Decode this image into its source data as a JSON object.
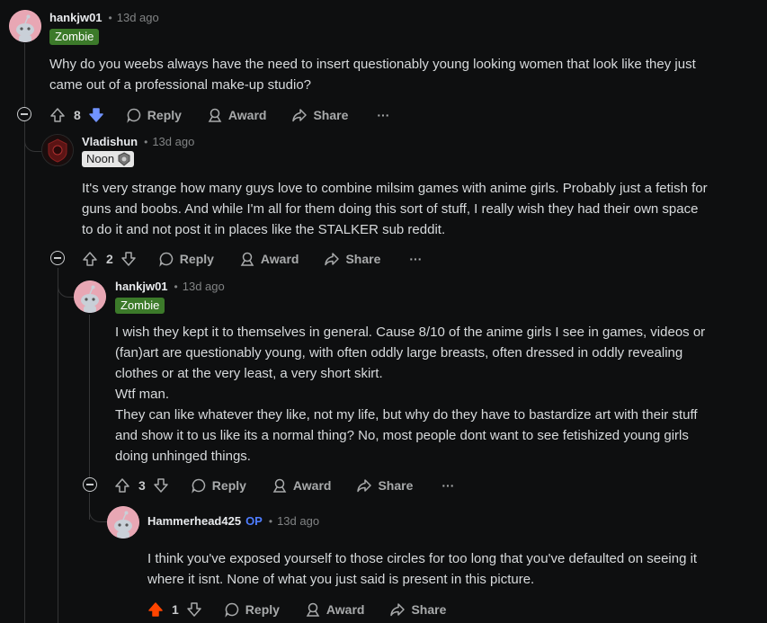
{
  "comments": [
    {
      "username": "hankjw01",
      "time": "13d ago",
      "flair": "Zombie",
      "lines": [
        "Why do you weebs always have the need to insert questionably young looking women that look like they just",
        "came out of a professional make-up studio?"
      ],
      "votes": "8",
      "vote_state": "downvoted"
    },
    {
      "username": "Vladishun",
      "time": "13d ago",
      "flair": "Noon",
      "lines": [
        "It's very strange how many guys love to combine milsim games with anime girls. Probably just a fetish for",
        "guns and boobs. And while I'm all for them doing this sort of stuff, I really wish they had their own space",
        "to do it and not post it in places like the STALKER sub reddit."
      ],
      "votes": "2",
      "vote_state": "none"
    },
    {
      "username": "hankjw01",
      "time": "13d ago",
      "flair": "Zombie",
      "lines": [
        "I wish they kept it to themselves in general. Cause 8/10 of the anime girls I see in games, videos or",
        "(fan)art are questionably young, with often oddly large breasts, often dressed in oddly revealing",
        "clothes or at the very least, a very short skirt.",
        "Wtf man.",
        "They can like whatever they like, not my life, but why do they have to bastardize art with their stuff",
        "and show it to us like its a normal thing? No, most people dont want to see fetishized young girls",
        "doing unhinged things."
      ],
      "votes": "3",
      "vote_state": "none"
    },
    {
      "username": "Hammerhead425",
      "op_badge": "OP",
      "time": "13d ago",
      "lines": [
        "I think you've exposed yourself to those circles for too long that you've defaulted on seeing it",
        "where it isnt. None of what you just said is present in this picture."
      ],
      "votes": "1",
      "vote_state": "upvoted"
    }
  ],
  "actions": {
    "reply": "Reply",
    "award": "Award",
    "share": "Share",
    "more": "···"
  },
  "colors": {
    "upvote": "#ff4500",
    "downvote": "#7193ff",
    "op": "#4f7dff",
    "zombie_flair": "#3c7a2a"
  }
}
